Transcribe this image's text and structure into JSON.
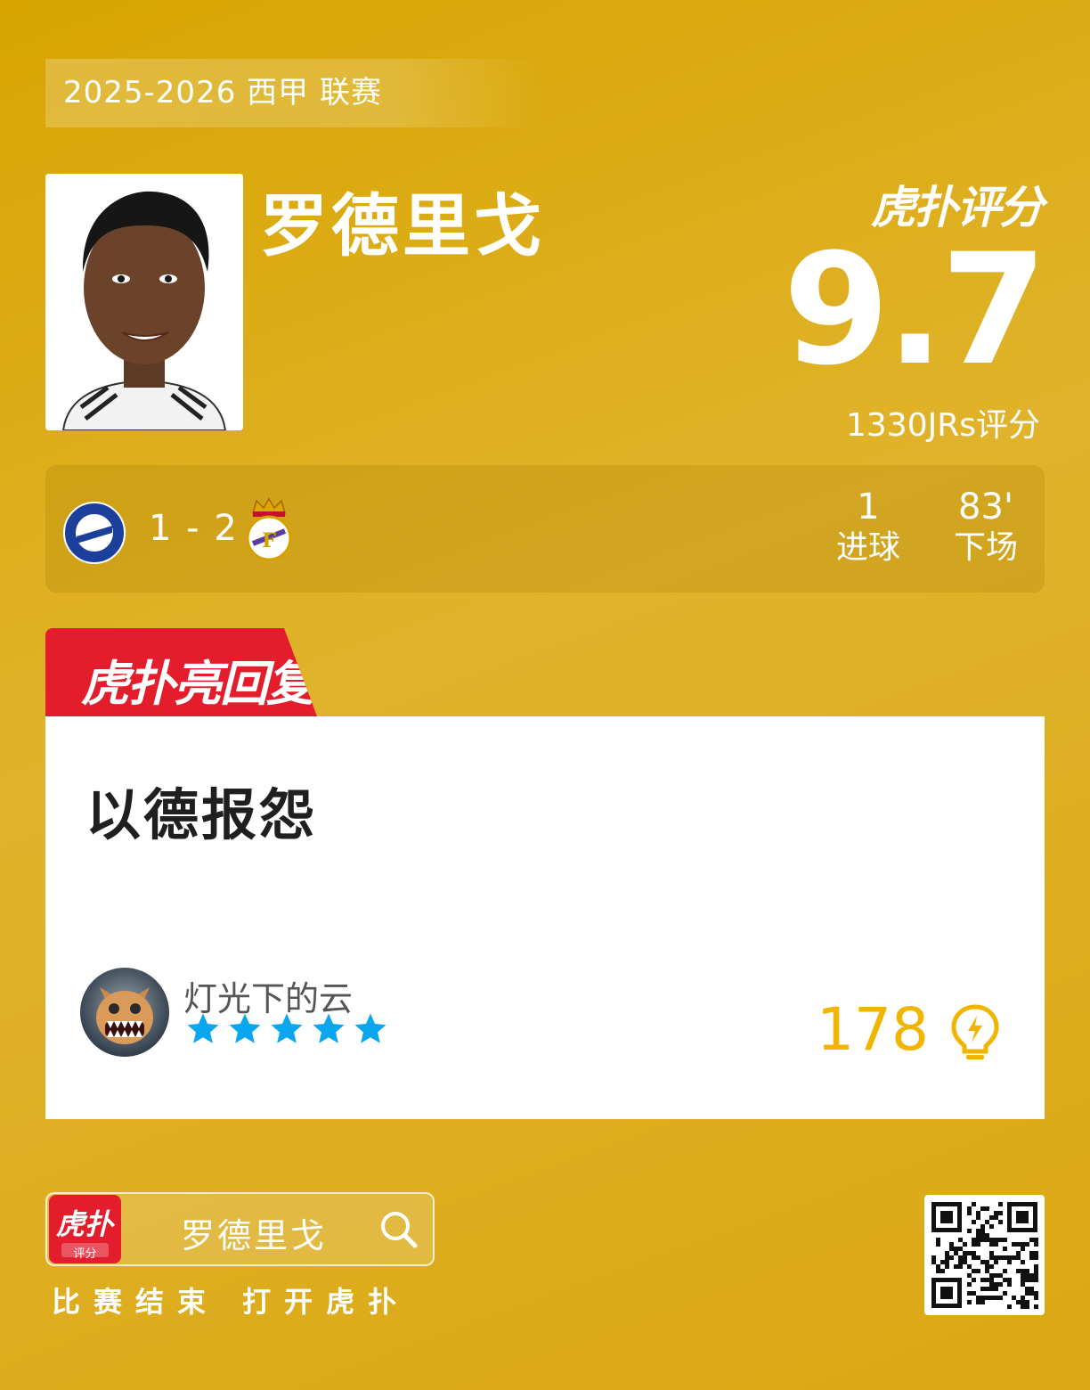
{
  "season": "2025-2026 西甲 联赛",
  "player": {
    "name": "罗德里戈"
  },
  "brand": "虎扑评分",
  "rating": {
    "score": "9.7",
    "votes": "1330JRs评分"
  },
  "match": {
    "score": "1 - 2",
    "home_team_icon": "alaves-badge-icon",
    "away_team_icon": "real-madrid-badge-icon",
    "stats": [
      {
        "value": "1",
        "label": "进球"
      },
      {
        "value": "83'",
        "label": "下场"
      }
    ]
  },
  "reply_tag": "虎扑亮回复",
  "reply": {
    "text": "以德报怨",
    "user": "灯光下的云",
    "stars": 5,
    "likes": "178"
  },
  "footer": {
    "app_icon_label": "评分",
    "search_text": "罗德里戈",
    "caption": "比赛结束 打开虎扑"
  },
  "colors": {
    "accent": "#f1b400",
    "tag": "#e31d2c",
    "star": "#0aa6f0"
  }
}
